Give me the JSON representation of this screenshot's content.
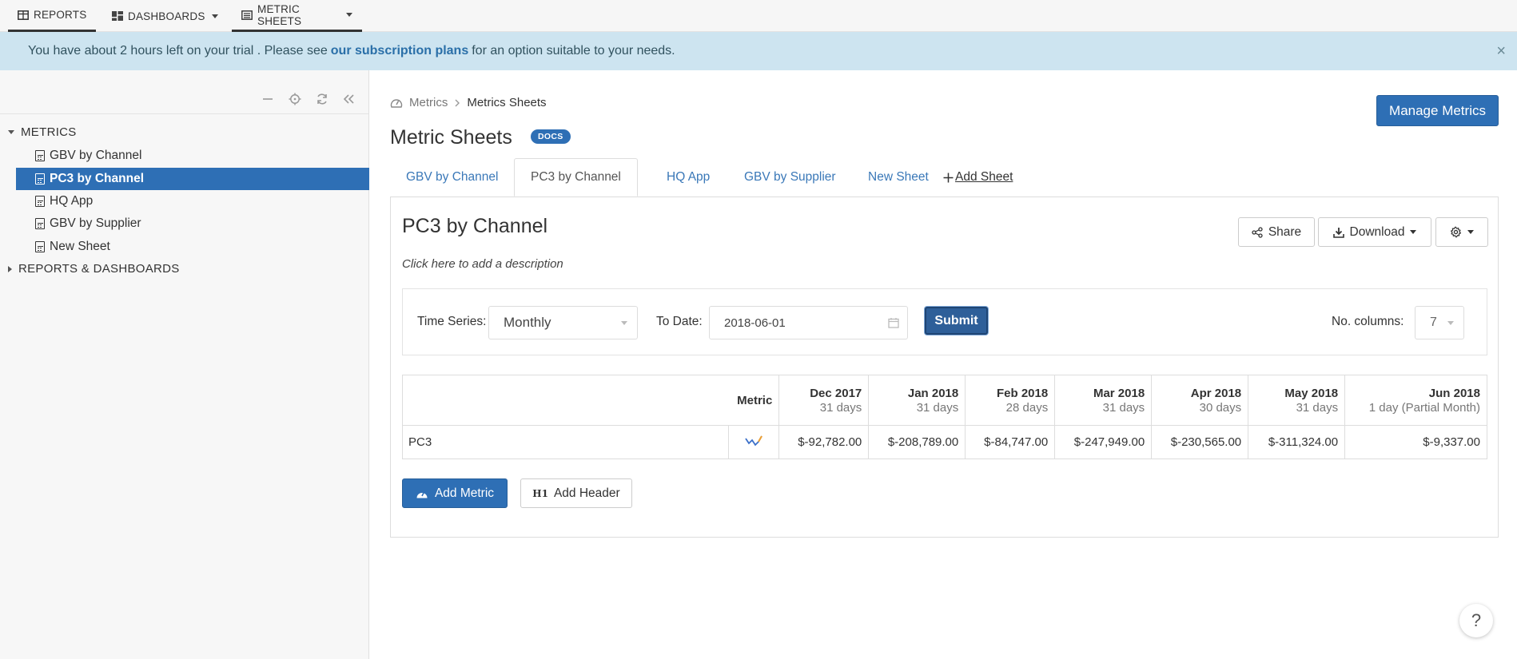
{
  "topnav": {
    "reports": "REPORTS",
    "dashboards": "DASHBOARDS",
    "metric_sheets": "METRIC SHEETS"
  },
  "banner": {
    "text_before": "You have about 2 hours left on your trial . Please see",
    "link": "our subscription plans",
    "text_after": "for an option suitable to your needs.",
    "close": "×"
  },
  "sidebar": {
    "metrics_root": "METRICS",
    "items": [
      {
        "label": "GBV by Channel"
      },
      {
        "label": "PC3 by Channel"
      },
      {
        "label": "HQ App"
      },
      {
        "label": "GBV by Supplier"
      },
      {
        "label": "New Sheet"
      }
    ],
    "reports_root": "REPORTS & DASHBOARDS"
  },
  "breadcrumb": {
    "parent": "Metrics",
    "current": "Metrics Sheets"
  },
  "page": {
    "title": "Metric Sheets",
    "docs_badge": "DOCS",
    "manage_button": "Manage Metrics"
  },
  "tabs": [
    {
      "label": "GBV by Channel"
    },
    {
      "label": "PC3 by Channel"
    },
    {
      "label": "HQ App"
    },
    {
      "label": "GBV by Supplier"
    },
    {
      "label": "New Sheet"
    }
  ],
  "add_sheet": "Add Sheet",
  "sheet": {
    "title": "PC3 by Channel",
    "description": "Click here to add a description",
    "share": "Share",
    "download": "Download"
  },
  "filters": {
    "time_series_label": "Time Series:",
    "time_series_value": "Monthly",
    "to_date_label": "To Date:",
    "to_date_value": "2018-06-01",
    "submit": "Submit",
    "columns_label": "No. columns:",
    "columns_value": "7"
  },
  "table": {
    "metric_header": "Metric",
    "columns": [
      {
        "month": "Dec 2017",
        "days": "31 days"
      },
      {
        "month": "Jan 2018",
        "days": "31 days"
      },
      {
        "month": "Feb 2018",
        "days": "28 days"
      },
      {
        "month": "Mar 2018",
        "days": "31 days"
      },
      {
        "month": "Apr 2018",
        "days": "30 days"
      },
      {
        "month": "May 2018",
        "days": "31 days"
      },
      {
        "month": "Jun 2018",
        "days": "1 day (Partial Month)"
      }
    ],
    "rows": [
      {
        "name": "PC3",
        "values": [
          "$-92,782.00",
          "$-208,789.00",
          "$-84,747.00",
          "$-247,949.00",
          "$-230,565.00",
          "$-311,324.00",
          "$-9,337.00"
        ]
      }
    ]
  },
  "actions": {
    "add_metric": "Add Metric",
    "add_header_icon": "H1",
    "add_header": "Add Header"
  },
  "help": "?",
  "colors": {
    "primary": "#2e6fb5",
    "banner_bg": "#cde4f0",
    "selected_item": "#2e6fb5"
  }
}
